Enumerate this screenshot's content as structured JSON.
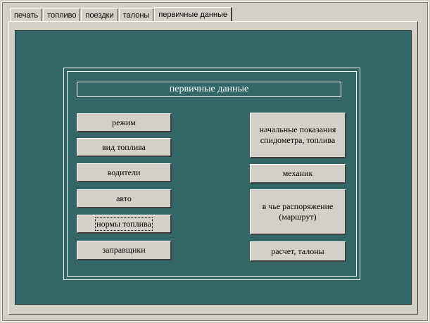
{
  "tabs": [
    {
      "label": "печать"
    },
    {
      "label": "топливо"
    },
    {
      "label": "поездки"
    },
    {
      "label": "талоны"
    },
    {
      "label": "первичные данные",
      "active": true
    }
  ],
  "panel": {
    "title": "первичные данные"
  },
  "left_buttons": [
    {
      "label": "режим"
    },
    {
      "label": "вид топлива"
    },
    {
      "label": "водители"
    },
    {
      "label": "авто"
    },
    {
      "label": "нормы топлива",
      "focused": true
    },
    {
      "label": "заправщики"
    }
  ],
  "right_buttons": [
    {
      "label": "начальные показания\nспидометра, топлива"
    },
    {
      "label": "механик"
    },
    {
      "label": "в чье распоряжение\n(маршрут)"
    },
    {
      "label": "расчет, талоны"
    }
  ],
  "colors": {
    "face": "#d4d0c8",
    "panel_bg": "#336666",
    "title_text": "#ffffff"
  }
}
